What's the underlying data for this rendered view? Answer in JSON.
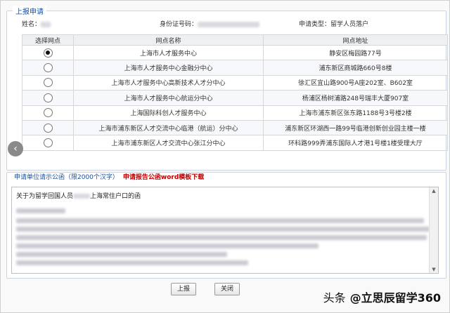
{
  "section_title": "上报申请",
  "info": {
    "name_label": "姓名：",
    "id_label": "身份证号码：",
    "type_label": "申请类型：",
    "type_value": "留学人员落户"
  },
  "table": {
    "headers": [
      "选择网点",
      "网点名称",
      "网点地址"
    ],
    "selected_index": 0,
    "rows": [
      {
        "name": "上海市人才服务中心",
        "address": "静安区梅园路77号"
      },
      {
        "name": "上海市人才服务中心金融分中心",
        "address": "浦东新区商城路660号8楼"
      },
      {
        "name": "上海市人才服务中心高新技术人才分中心",
        "address": "徐汇区宜山路900号A座202室、B602室"
      },
      {
        "name": "上海市人才服务中心航运分中心",
        "address": "杨浦区杨树浦路248号瑞丰大厦907室"
      },
      {
        "name": "上海国际科创人才服务中心",
        "address": "上海市浦东新区张东路1188号3号楼2楼"
      },
      {
        "name": "上海市浦东新区人才交流中心临港（航运）分中心",
        "address": "浦东新区环湖西一路99号临港创新创业园主楼一楼"
      },
      {
        "name": "上海市浦东新区人才交流中心张江分中心",
        "address": "环科路999弄浦东国际人才港1号楼1楼受理大厅"
      }
    ]
  },
  "notice": {
    "label": "申请单位请示公函（限2000个汉字）",
    "download_link": "申请报告公函word模板下载",
    "first_line_prefix": "关于为留学回国人员",
    "first_line_suffix": "上海常住户口的函"
  },
  "buttons": {
    "submit": "上报",
    "close": "关闭"
  },
  "watermark": {
    "platform": "头条",
    "account": "@立思辰留学360"
  }
}
